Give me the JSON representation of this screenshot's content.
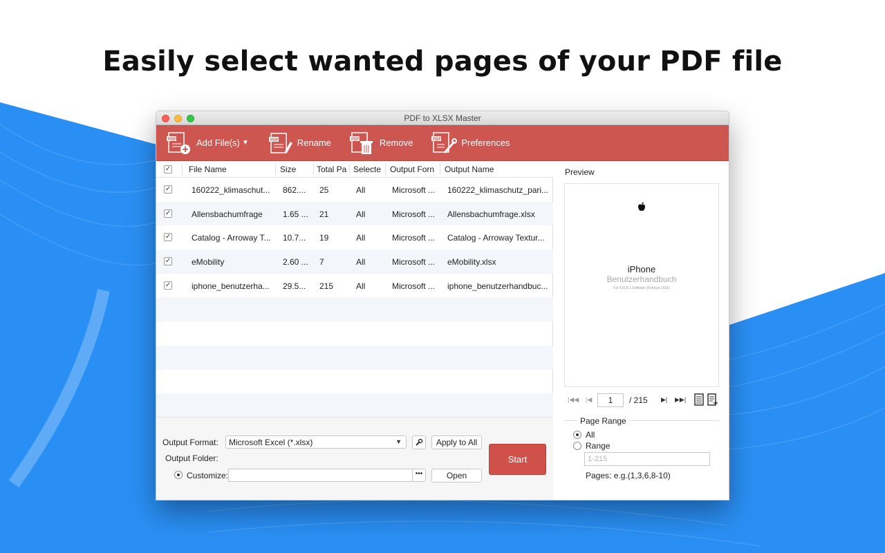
{
  "headline": "Easily select wanted pages of your PDF file",
  "window": {
    "title": "PDF to XLSX Master"
  },
  "colors": {
    "accent": "#cd5650",
    "background_blue": "#2a8ff4",
    "start_button": "#d0504a"
  },
  "toolbar": {
    "add_files": "Add File(s)",
    "rename": "Rename",
    "remove": "Remove",
    "preferences": "Preferences"
  },
  "table": {
    "headers": [
      "File Name",
      "Size",
      "Total Pa",
      "Selecte",
      "Output Forn",
      "Output Name"
    ],
    "rows": [
      {
        "checked": true,
        "name": "160222_klimaschut...",
        "size": "862....",
        "total": "25",
        "selected": "All",
        "format": "Microsoft ...",
        "output": "160222_klimaschutz_pari..."
      },
      {
        "checked": true,
        "name": "Allensbachumfrage",
        "size": "1.65 ...",
        "total": "21",
        "selected": "All",
        "format": "Microsoft ...",
        "output": "Allensbachumfrage.xlsx"
      },
      {
        "checked": true,
        "name": "Catalog - Arroway T...",
        "size": "10.7...",
        "total": "19",
        "selected": "All",
        "format": "Microsoft ...",
        "output": "Catalog - Arroway Textur..."
      },
      {
        "checked": true,
        "name": "eMobility",
        "size": "2.60 ...",
        "total": "7",
        "selected": "All",
        "format": "Microsoft ...",
        "output": "eMobility.xlsx"
      },
      {
        "checked": true,
        "name": "iphone_benutzerha...",
        "size": "29.5...",
        "total": "215",
        "selected": "All",
        "format": "Microsoft ...",
        "output": "iphone_benutzerhandbuc..."
      }
    ]
  },
  "bottom": {
    "output_format_label": "Output Format:",
    "output_format_value": "Microsoft Excel (*.xlsx)",
    "apply_to_all": "Apply to All",
    "output_folder_label": "Output Folder:",
    "customize_label": "Customize:",
    "customize_value": "",
    "browse": "•••",
    "open": "Open",
    "start": "Start"
  },
  "preview": {
    "label": "Preview",
    "doc_title": "iPhone",
    "doc_subtitle": "Benutzerhandbuch",
    "doc_small": "Für iOS 8.1 Software (Februar 2015)",
    "current_page": "1",
    "total_pages": "/ 215"
  },
  "page_range": {
    "title": "Page Range",
    "option_all": "All",
    "option_range": "Range",
    "range_placeholder": "1-215",
    "hint": "Pages: e.g.(1,3,6,8-10)"
  }
}
